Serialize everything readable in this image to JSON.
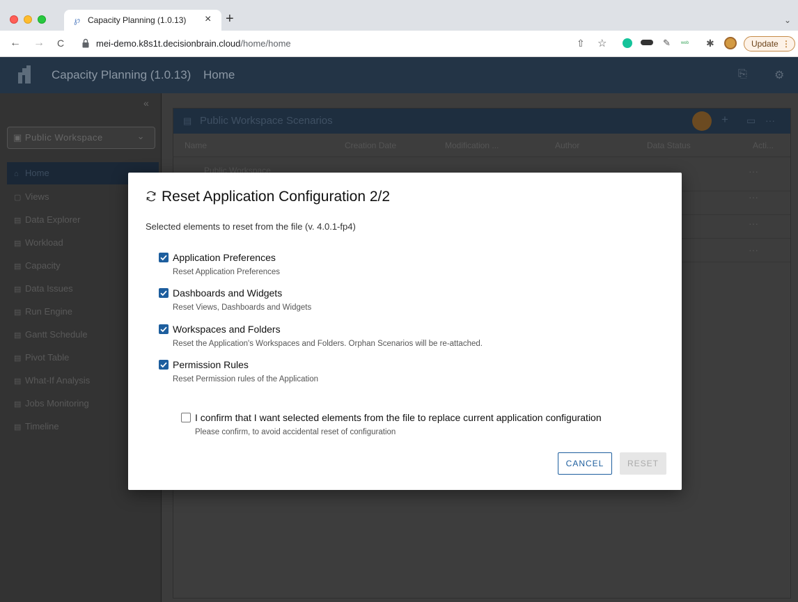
{
  "browser": {
    "tab_title": "Capacity Planning (1.0.13)",
    "tab_close": "×",
    "new_tab": "+",
    "tab_dropdown": "⌄",
    "url_host": "mei-demo.k8s1t.decisionbrain.cloud",
    "url_path": "/home/home",
    "update_label": "Update",
    "update_menu": "⋮",
    "nav_back": "←",
    "nav_forward": "→",
    "nav_reload": "C",
    "share_icon": "⇧",
    "star_icon": "☆",
    "ext_text": "ʷᵉᵇ",
    "puzzle_icon": "✱"
  },
  "app": {
    "title": "Capacity Planning (1.0.13)",
    "page": "Home"
  },
  "sidebar": {
    "collapse": "«",
    "workspace_select": "Public Workspace",
    "workspace_chevron": "⌄",
    "items": [
      {
        "label": "Home",
        "icon": "⌂"
      },
      {
        "label": "Views",
        "icon": "▢"
      },
      {
        "label": "Data Explorer",
        "icon": "▤"
      },
      {
        "label": "Workload",
        "icon": "▤"
      },
      {
        "label": "Capacity",
        "icon": "▤"
      },
      {
        "label": "Data Issues",
        "icon": "▤"
      },
      {
        "label": "Run Engine",
        "icon": "▤"
      },
      {
        "label": "Gantt Schedule",
        "icon": "▤"
      },
      {
        "label": "Pivot Table",
        "icon": "▤"
      },
      {
        "label": "What-If Analysis",
        "icon": "▤"
      },
      {
        "label": "Jobs Monitoring",
        "icon": "▤"
      },
      {
        "label": "Timeline",
        "icon": "▤"
      }
    ]
  },
  "panel": {
    "title": "Public Workspace Scenarios",
    "columns": [
      "Name",
      "Creation Date",
      "Modification ...",
      "Author",
      "Data Status",
      "Acti..."
    ],
    "first_row": "Public Workspace",
    "row_actions": "···",
    "add_icon": "+",
    "more_icon": "···"
  },
  "modal": {
    "title": "Reset Application Configuration 2/2",
    "subtitle": "Selected elements to reset from the file (v. 4.0.1-fp4)",
    "options": [
      {
        "label": "Application Preferences",
        "description": "Reset Application Preferences",
        "checked": true
      },
      {
        "label": "Dashboards and Widgets",
        "description": "Reset Views, Dashboards and Widgets",
        "checked": true
      },
      {
        "label": "Workspaces and Folders",
        "description": "Reset the Application's Workspaces and Folders. Orphan Scenarios will be re-attached.",
        "checked": true
      },
      {
        "label": "Permission Rules",
        "description": "Reset Permission rules of the Application",
        "checked": true
      }
    ],
    "confirm": {
      "label": "I confirm that I want selected elements from the file to replace current application configuration",
      "description": "Please confirm, to avoid accidental reset of configuration",
      "checked": false
    },
    "cancel_label": "CANCEL",
    "reset_label": "RESET"
  },
  "colors": {
    "accent": "#1d5e9e",
    "header_bg": "#233446",
    "update_border": "#c58a47"
  }
}
